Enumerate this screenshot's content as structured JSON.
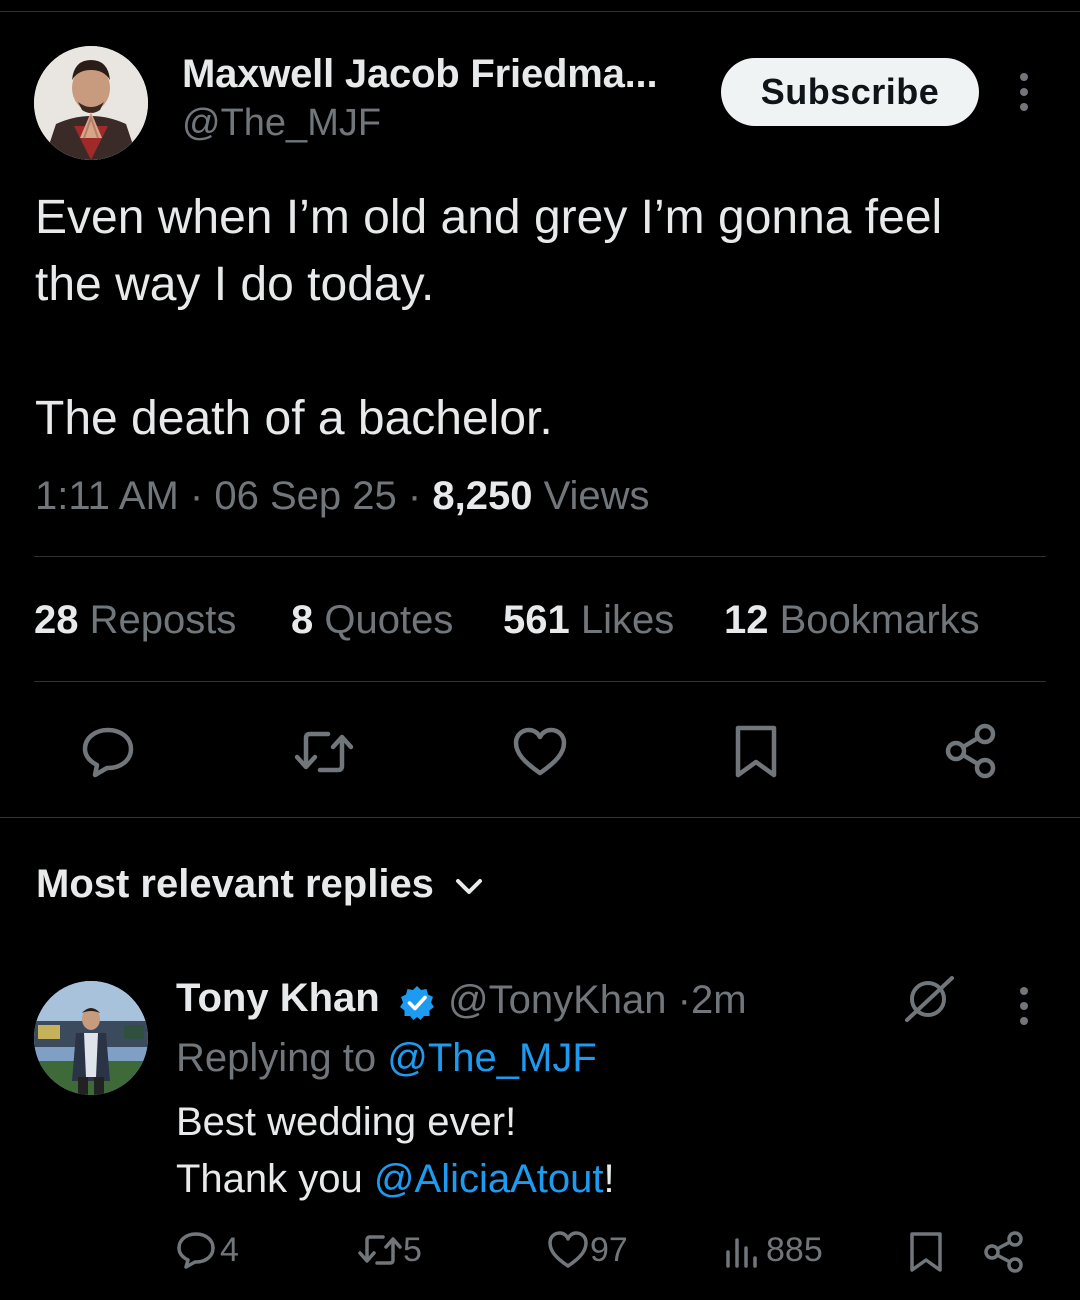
{
  "tweet": {
    "author_name": "Maxwell Jacob Friedma...",
    "author_handle": "@The_MJF",
    "subscribe_label": "Subscribe",
    "text_lines": [
      "Even when I’m old and grey I’m gonna feel",
      "the way I do today.",
      "The death of a bachelor."
    ],
    "time": "1:11 AM",
    "date": "06 Sep 25",
    "views_count": "8,250",
    "views_label": "Views",
    "separator": "·",
    "stats": {
      "reposts_count": "28",
      "reposts_label": "Reposts",
      "quotes_count": "8",
      "quotes_label": "Quotes",
      "likes_count": "561",
      "likes_label": "Likes",
      "bookmarks_count": "12",
      "bookmarks_label": "Bookmarks"
    },
    "actions": [
      "reply-icon",
      "repost-icon",
      "like-icon",
      "bookmark-icon",
      "share-icon"
    ]
  },
  "replies_section": {
    "sort_label": "Most relevant replies"
  },
  "reply": {
    "author_name": "Tony Khan",
    "author_handle": "@TonyKhan",
    "time": "2m",
    "replying_prefix": "Replying to",
    "replying_handle": "@The_MJF",
    "line1": "Best wedding ever!",
    "line2_prefix": "Thank you",
    "line2_mention": "@AliciaAtout",
    "line2_suffix": "!",
    "reply_count": "4",
    "repost_count": "5",
    "like_count": "97",
    "view_count": "885"
  },
  "colors": {
    "background": "#000000",
    "text": "#e7e9ea",
    "secondary": "#71767b",
    "accent": "#1d9bf0",
    "divider": "#2f3336"
  }
}
